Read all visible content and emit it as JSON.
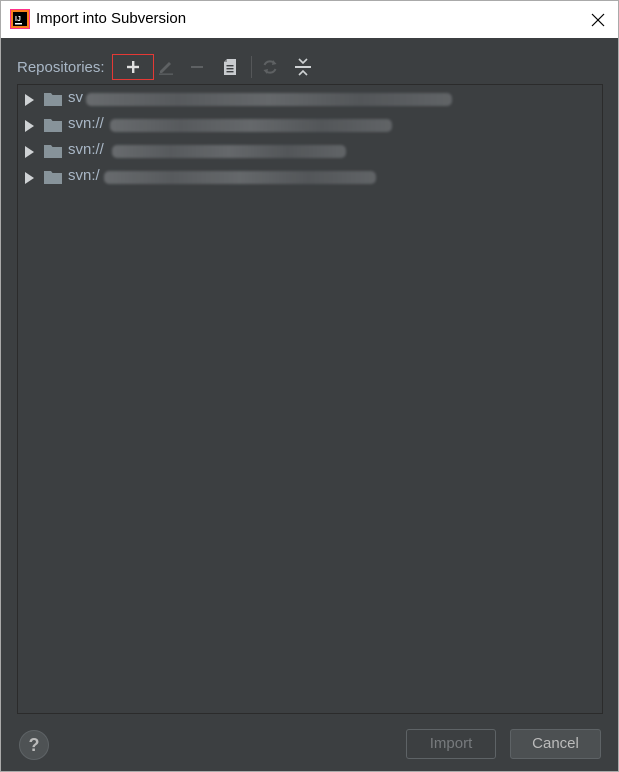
{
  "window": {
    "title": "Import into Subversion"
  },
  "toolbar": {
    "label": "Repositories:",
    "buttons": [
      {
        "icon": "plus-icon",
        "state": "enabled",
        "highlighted": true
      },
      {
        "icon": "pencil-icon",
        "state": "disabled"
      },
      {
        "icon": "minus-icon",
        "state": "disabled"
      },
      {
        "icon": "clipboard-icon",
        "state": "enabled"
      },
      {
        "icon": "refresh-icon",
        "state": "disabled"
      },
      {
        "icon": "collapse-icon",
        "state": "enabled"
      }
    ]
  },
  "repositories": [
    {
      "visible_text": "sv",
      "obscured": true
    },
    {
      "visible_text": "svn://",
      "obscured": true
    },
    {
      "visible_text": "svn://",
      "obscured": true
    },
    {
      "visible_text": "svn:/",
      "obscured": true
    }
  ],
  "footer": {
    "help_label": "?",
    "import_label": "Import",
    "cancel_label": "Cancel"
  },
  "colors": {
    "background": "#3c3f41",
    "text": "#a9b7c6",
    "highlight_border": "#e53935"
  }
}
